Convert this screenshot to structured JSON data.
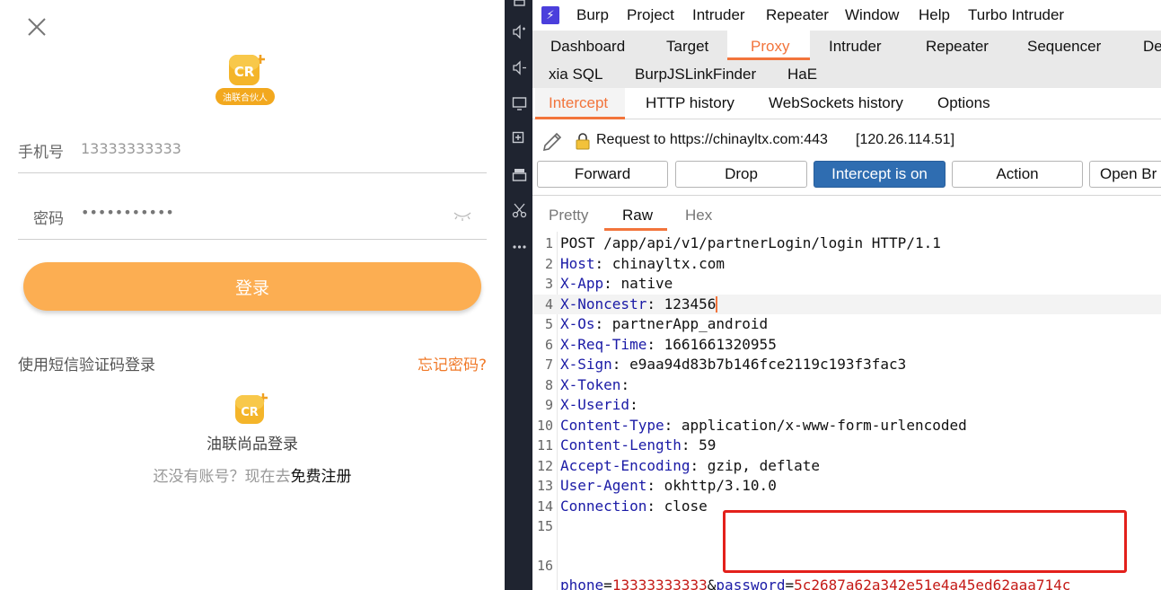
{
  "mobile": {
    "phone_label": "手机号",
    "phone_value": "13333333333",
    "password_label": "密码",
    "password_value": "•••••••••••",
    "login_button": "登录",
    "sms_login_link": "使用短信验证码登录",
    "forgot_link": "忘记密码?",
    "brand_login": "油联尚品登录",
    "no_account_text": "还没有账号？现在去",
    "register_link": "免费注册",
    "logo_text": "CR",
    "logo_banner": "油联合伙人",
    "accent_color": "#fcae52"
  },
  "burp": {
    "app_name": "Burp",
    "menu": [
      "Project",
      "Intruder",
      "Repeater",
      "Window",
      "Help",
      "Turbo Intruder"
    ],
    "top_tabs_row1": [
      "Dashboard",
      "Target",
      "Proxy",
      "Intruder",
      "Repeater",
      "Sequencer",
      "De"
    ],
    "top_tabs_row2": [
      "xia SQL",
      "BurpJSLinkFinder",
      "HaE"
    ],
    "proxy_tabs": [
      "Intercept",
      "HTTP history",
      "WebSockets history",
      "Options"
    ],
    "request_label": "Request to https://chinayltx.com:443",
    "request_ip": "[120.26.114.51]",
    "buttons": [
      "Forward",
      "Drop",
      "Intercept is on",
      "Action",
      "Open Br"
    ],
    "editor_tabs": [
      "Pretty",
      "Raw",
      "Hex"
    ],
    "request_lines": [
      {
        "n": "1",
        "key": "",
        "sep": "",
        "val": "POST /app/api/v1/partnerLogin/login HTTP/1.1"
      },
      {
        "n": "2",
        "key": "Host",
        "sep": ": ",
        "val": "chinayltx.com"
      },
      {
        "n": "3",
        "key": "X-App",
        "sep": ": ",
        "val": "native"
      },
      {
        "n": "4",
        "key": "X-Noncestr",
        "sep": ": ",
        "val": "123456"
      },
      {
        "n": "5",
        "key": "X-Os",
        "sep": ": ",
        "val": "partnerApp_android"
      },
      {
        "n": "6",
        "key": "X-Req-Time",
        "sep": ": ",
        "val": "1661661320955"
      },
      {
        "n": "7",
        "key": "X-Sign",
        "sep": ": ",
        "val": "e9aa94d83b7b146fce2119c193f3fac3"
      },
      {
        "n": "8",
        "key": "X-Token",
        "sep": ":",
        "val": ""
      },
      {
        "n": "9",
        "key": "X-Userid",
        "sep": ":",
        "val": ""
      },
      {
        "n": "10",
        "key": "Content-Type",
        "sep": ": ",
        "val": "application/x-www-form-urlencoded"
      },
      {
        "n": "11",
        "key": "Content-Length",
        "sep": ": ",
        "val": "59"
      },
      {
        "n": "12",
        "key": "Accept-Encoding",
        "sep": ": ",
        "val": "gzip, deflate"
      },
      {
        "n": "13",
        "key": "User-Agent",
        "sep": ": ",
        "val": "okhttp/3.10.0"
      },
      {
        "n": "14",
        "key": "Connection",
        "sep": ": ",
        "val": "close"
      },
      {
        "n": "15",
        "key": "",
        "sep": "",
        "val": ""
      }
    ],
    "body_line": {
      "n": "16",
      "p1": "phone",
      "eq1": "=",
      "v1": "13333333333",
      "amp": "&",
      "p2": "password",
      "eq2": "=",
      "v2": "5c2687a62a342e51e4a45ed62aaa714c"
    },
    "accent_color": "#f2743b",
    "intercept_on_color": "#2f6db1",
    "highlight_color": "#e3201b"
  }
}
